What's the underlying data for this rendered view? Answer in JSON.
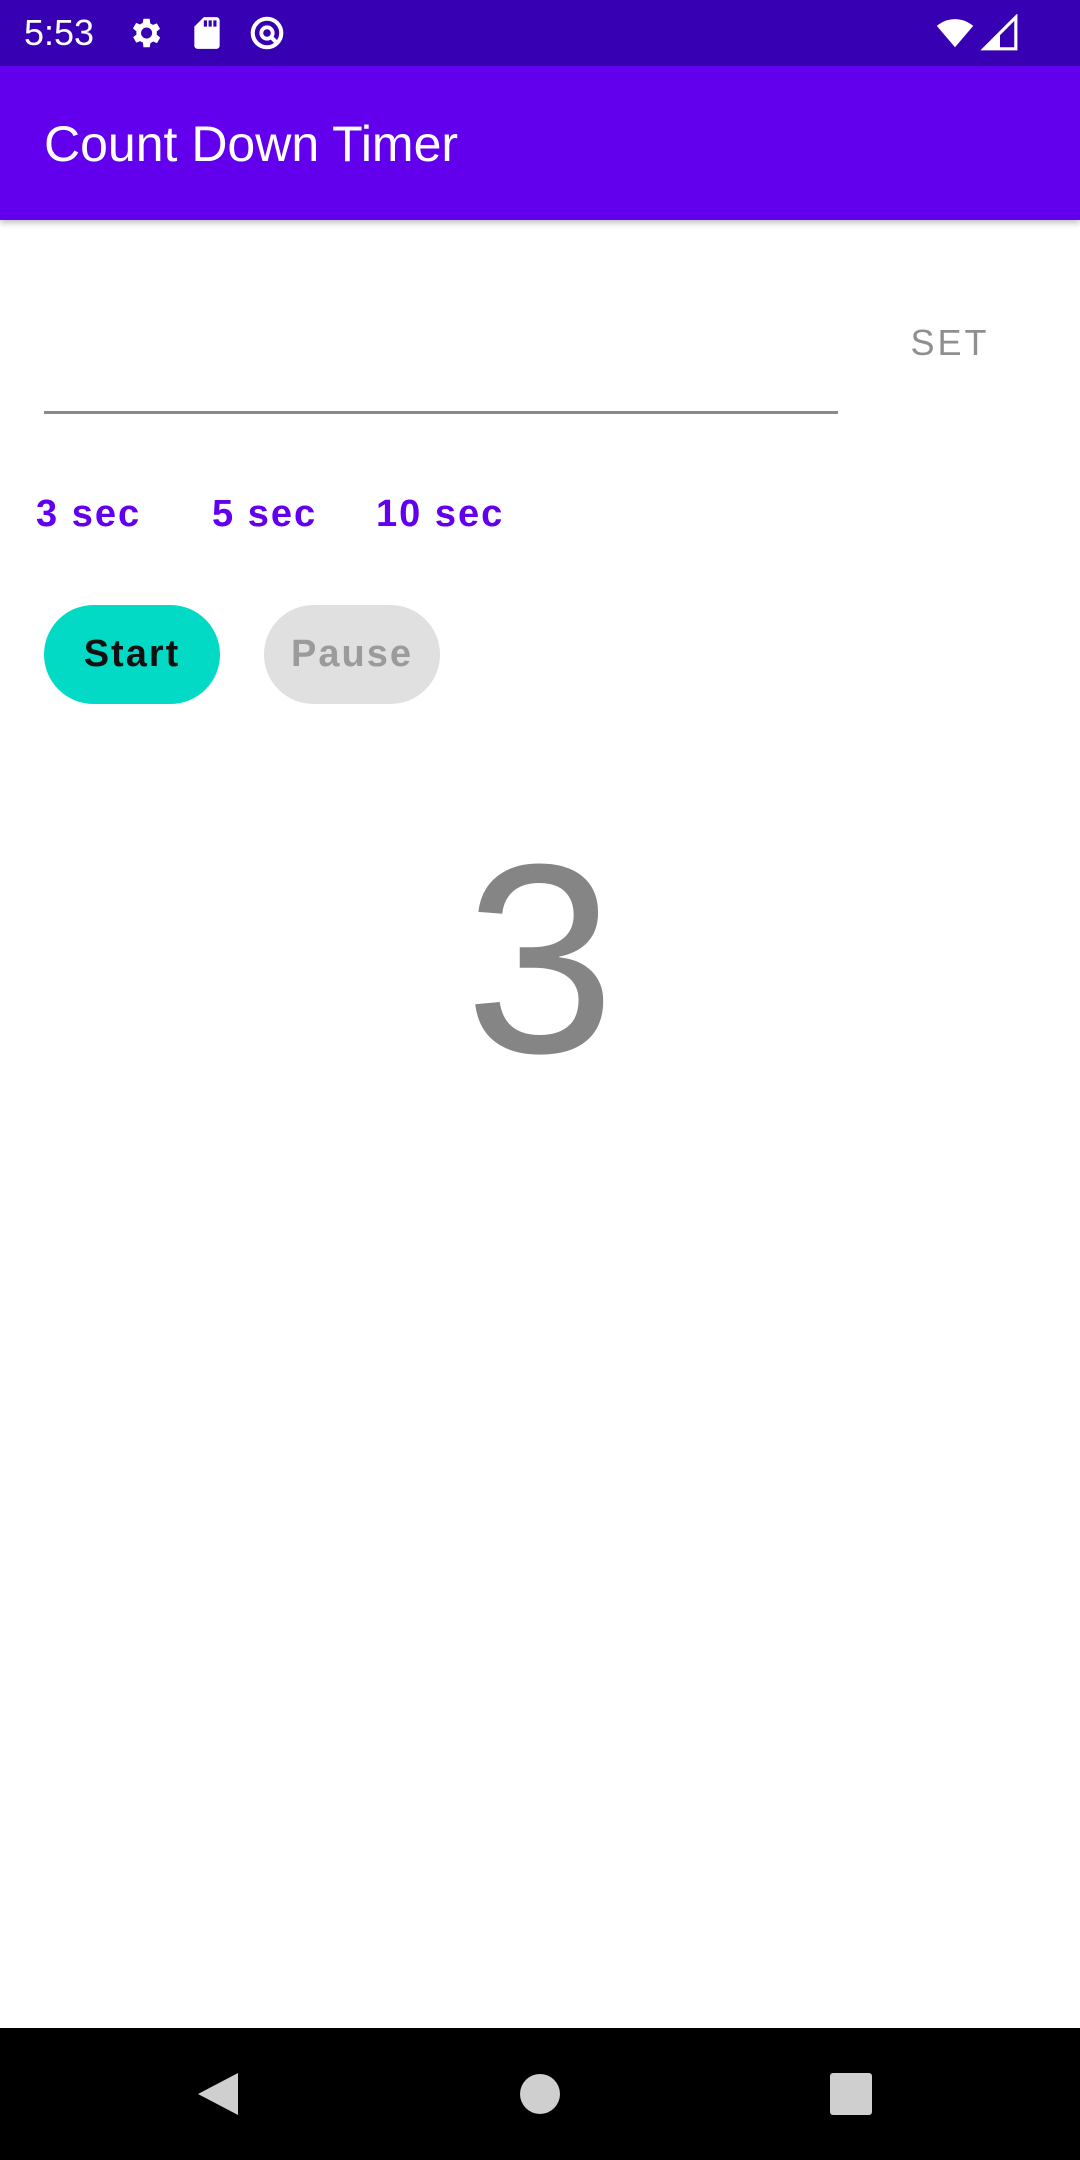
{
  "status_bar": {
    "time": "5:53",
    "left_icons": [
      "gear-icon",
      "sd-card-icon",
      "vpn-key-icon"
    ],
    "right_icons": [
      "wifi-icon",
      "cell-signal-icon"
    ],
    "background": "#3700b3"
  },
  "app_bar": {
    "title": "Count Down Timer",
    "background": "#6200ee"
  },
  "timer_input": {
    "value": "",
    "placeholder": ""
  },
  "set_button": {
    "label": "SET"
  },
  "presets": [
    {
      "label": "3 sec"
    },
    {
      "label": "5 sec"
    },
    {
      "label": "10 sec"
    }
  ],
  "controls": {
    "start_label": "Start",
    "pause_label": "Pause",
    "start_color": "#03dac5",
    "pause_color": "#e0e0e0"
  },
  "counter": {
    "value": "3"
  },
  "nav_bar": {
    "buttons": [
      "back-icon",
      "home-icon",
      "recents-icon"
    ]
  },
  "colors": {
    "accent": "#6200ee",
    "secondary": "#03dac5"
  }
}
